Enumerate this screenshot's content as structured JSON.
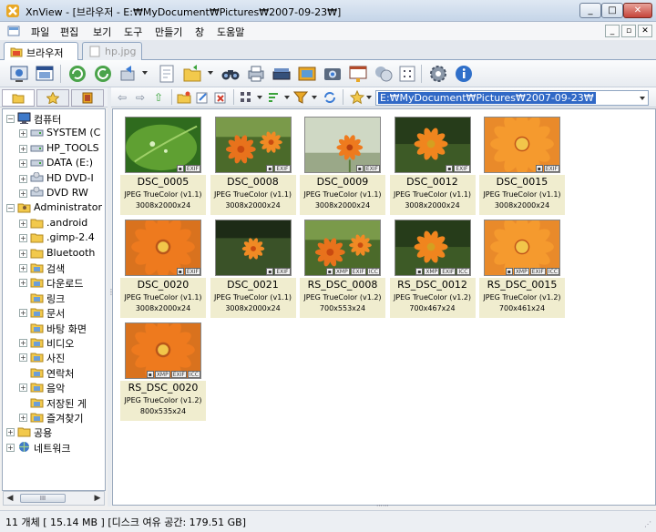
{
  "window": {
    "title": "XnView - [브라우저 - E:₩MyDocument₩Pictures₩2007-09-23₩]",
    "minimize": "_",
    "maximize": "□",
    "close": "✕"
  },
  "menu": {
    "items": [
      "파일",
      "편집",
      "보기",
      "도구",
      "만들기",
      "창",
      "도움말"
    ],
    "mdi_buttons": [
      "_",
      "▫",
      "✕"
    ]
  },
  "tabs": [
    {
      "label": "브라우저",
      "active": true
    },
    {
      "label": "hp.jpg",
      "active": false
    }
  ],
  "toolbar": {
    "icons": [
      "fullscreen-icon",
      "window-icon",
      "refresh-icon",
      "rotate-icon",
      "transfer-icon",
      "new-file-icon",
      "open-folder-icon",
      "binoculars-icon",
      "print-icon",
      "scanner-icon",
      "slideshow-icon",
      "capture-icon",
      "webpage-icon",
      "convert-icon",
      "layout-icon",
      "settings-icon",
      "info-icon"
    ]
  },
  "sidebar": {
    "tabs": [
      "folders-icon",
      "favorites-icon",
      "categories-icon"
    ],
    "tree": [
      {
        "label": "컴퓨터",
        "level": 0,
        "expander": "−",
        "icon": "computer-icon"
      },
      {
        "label": "SYSTEM (C",
        "level": 1,
        "expander": "+",
        "icon": "drive-icon"
      },
      {
        "label": "HP_TOOLS",
        "level": 1,
        "expander": "+",
        "icon": "drive-icon"
      },
      {
        "label": "DATA (E:)",
        "level": 1,
        "expander": "+",
        "icon": "drive-icon"
      },
      {
        "label": "HD DVD-I",
        "level": 1,
        "expander": "+",
        "icon": "dvd-drive-icon"
      },
      {
        "label": "DVD RW",
        "level": 1,
        "expander": "+",
        "icon": "dvd-drive-icon"
      },
      {
        "label": "Administrator",
        "level": 0,
        "expander": "−",
        "icon": "user-folder-icon"
      },
      {
        "label": ".android",
        "level": 1,
        "expander": "+",
        "icon": "folder-icon"
      },
      {
        "label": ".gimp-2.4",
        "level": 1,
        "expander": "+",
        "icon": "folder-icon"
      },
      {
        "label": "Bluetooth",
        "level": 1,
        "expander": "+",
        "icon": "folder-icon"
      },
      {
        "label": "검색",
        "level": 1,
        "expander": "+",
        "icon": "special-folder-icon"
      },
      {
        "label": "다운로드",
        "level": 1,
        "expander": "+",
        "icon": "special-folder-icon"
      },
      {
        "label": "링크",
        "level": 1,
        "expander": "",
        "icon": "special-folder-icon"
      },
      {
        "label": "문서",
        "level": 1,
        "expander": "+",
        "icon": "special-folder-icon"
      },
      {
        "label": "바탕 화면",
        "level": 1,
        "expander": "",
        "icon": "special-folder-icon"
      },
      {
        "label": "비디오",
        "level": 1,
        "expander": "+",
        "icon": "special-folder-icon"
      },
      {
        "label": "사진",
        "level": 1,
        "expander": "+",
        "icon": "special-folder-icon"
      },
      {
        "label": "연락처",
        "level": 1,
        "expander": "",
        "icon": "special-folder-icon"
      },
      {
        "label": "음악",
        "level": 1,
        "expander": "+",
        "icon": "special-folder-icon"
      },
      {
        "label": "저장된 게",
        "level": 1,
        "expander": "",
        "icon": "special-folder-icon"
      },
      {
        "label": "즐겨찾기",
        "level": 1,
        "expander": "+",
        "icon": "special-folder-icon"
      },
      {
        "label": "공용",
        "level": 0,
        "expander": "+",
        "icon": "folder-icon"
      },
      {
        "label": "네트워크",
        "level": 0,
        "expander": "+",
        "icon": "network-icon"
      }
    ],
    "scroll_thumb": "III"
  },
  "browser_toolbar": {
    "path": "E:₩MyDocument₩Pictures₩2007-09-23₩"
  },
  "thumbnails": [
    {
      "name": "DSC_0005",
      "type": "JPEG TrueColor (v1.1)",
      "size": "3008x2000x24",
      "badges": [
        "EXIF"
      ],
      "photo": "leaf"
    },
    {
      "name": "DSC_0008",
      "type": "JPEG TrueColor (v1.1)",
      "size": "3008x2000x24",
      "badges": [
        "EXIF"
      ],
      "photo": "flowers-wide"
    },
    {
      "name": "DSC_0009",
      "type": "JPEG TrueColor (v1.1)",
      "size": "3008x2000x24",
      "badges": [
        "EXIF"
      ],
      "photo": "flower-bud"
    },
    {
      "name": "DSC_0012",
      "type": "JPEG TrueColor (v1.1)",
      "size": "3008x2000x24",
      "badges": [
        "EXIF"
      ],
      "photo": "flower-dark"
    },
    {
      "name": "DSC_0015",
      "type": "JPEG TrueColor (v1.1)",
      "size": "3008x2000x24",
      "badges": [
        "EXIF"
      ],
      "photo": "flower-macro"
    },
    {
      "name": "DSC_0020",
      "type": "JPEG TrueColor (v1.1)",
      "size": "3008x2000x24",
      "badges": [
        "EXIF"
      ],
      "photo": "flower-full"
    },
    {
      "name": "DSC_0021",
      "type": "JPEG TrueColor (v1.1)",
      "size": "3008x2000x24",
      "badges": [
        "EXIF"
      ],
      "photo": "flower-small"
    },
    {
      "name": "RS_DSC_0008",
      "type": "JPEG TrueColor (v1.2)",
      "size": "700x553x24",
      "badges": [
        "XMP",
        "EXIF",
        "ICC"
      ],
      "photo": "flowers-wide"
    },
    {
      "name": "RS_DSC_0012",
      "type": "JPEG TrueColor (v1.2)",
      "size": "700x467x24",
      "badges": [
        "XMP",
        "EXIF",
        "ICC"
      ],
      "photo": "flower-dark"
    },
    {
      "name": "RS_DSC_0015",
      "type": "JPEG TrueColor (v1.2)",
      "size": "700x461x24",
      "badges": [
        "XMP",
        "EXIF",
        "ICC"
      ],
      "photo": "flower-macro"
    },
    {
      "name": "RS_DSC_0020",
      "type": "JPEG TrueColor (v1.2)",
      "size": "800x535x24",
      "badges": [
        "XMP",
        "EXIF",
        "ICC"
      ],
      "photo": "flower-full"
    }
  ],
  "status": {
    "text": "11 개체 [ 15.14 MB ] [디스크 여유 공간: 179.51 GB]"
  },
  "colors": {
    "selection": "#3169c6",
    "label_background": "#f0edcf"
  }
}
